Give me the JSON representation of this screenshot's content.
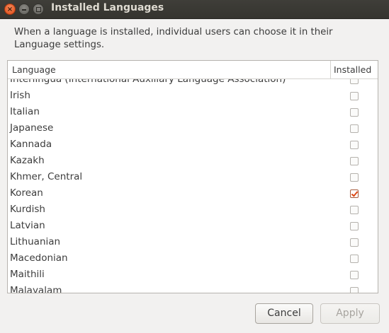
{
  "window": {
    "title": "Installed Languages",
    "close_glyph": "×",
    "close_icon": "close-icon",
    "minimize_icon": "minimize-icon",
    "maximize_icon": "maximize-icon"
  },
  "description": "When a language is installed, individual users can choose it in their Language settings.",
  "table": {
    "columns": [
      "Language",
      "Installed"
    ],
    "rows": [
      {
        "language": "Interlingua (International Auxiliary Language Association)",
        "installed": false
      },
      {
        "language": "Irish",
        "installed": false
      },
      {
        "language": "Italian",
        "installed": false
      },
      {
        "language": "Japanese",
        "installed": false
      },
      {
        "language": "Kannada",
        "installed": false
      },
      {
        "language": "Kazakh",
        "installed": false
      },
      {
        "language": "Khmer, Central",
        "installed": false
      },
      {
        "language": "Korean",
        "installed": true
      },
      {
        "language": "Kurdish",
        "installed": false
      },
      {
        "language": "Latvian",
        "installed": false
      },
      {
        "language": "Lithuanian",
        "installed": false
      },
      {
        "language": "Macedonian",
        "installed": false
      },
      {
        "language": "Maithili",
        "installed": false
      },
      {
        "language": "Malayalam",
        "installed": false
      }
    ]
  },
  "buttons": {
    "cancel": "Cancel",
    "apply": "Apply"
  },
  "colors": {
    "accent": "#dd4814",
    "titlebar": "#3c3b37"
  }
}
